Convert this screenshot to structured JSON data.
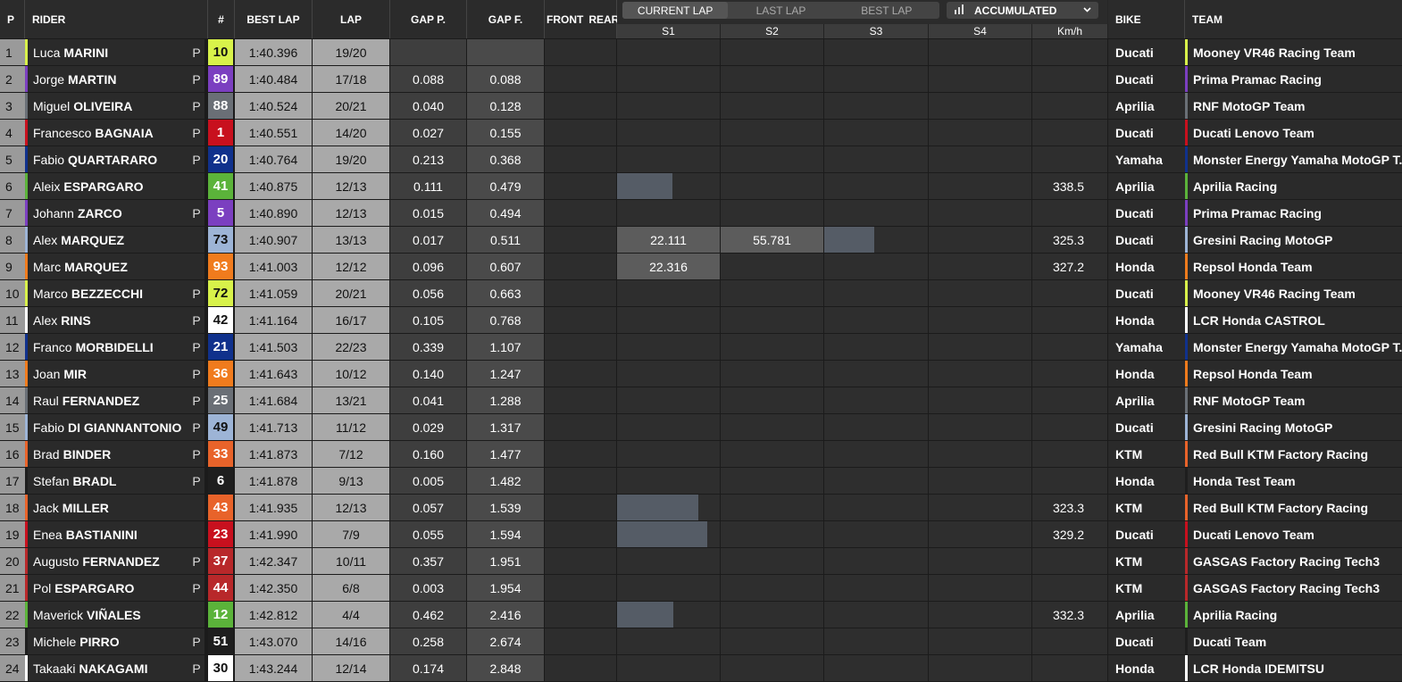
{
  "headers": {
    "p": "P",
    "rider": "RIDER",
    "num": "#",
    "best_lap": "BEST LAP",
    "lap": "LAP",
    "gap_p": "GAP P.",
    "gap_f": "GAP F.",
    "front": "FRONT",
    "rear": "REAR",
    "bike": "BIKE",
    "team": "TEAM",
    "sectors": [
      "S1",
      "S2",
      "S3",
      "S4",
      "Km/h"
    ]
  },
  "tabs": [
    "CURRENT LAP",
    "LAST LAP",
    "BEST LAP"
  ],
  "active_tab": "CURRENT LAP",
  "dropdown": {
    "label": "ACCUMULATED",
    "icon": "bar-chart-icon"
  },
  "rows": [
    {
      "pos": "1",
      "first": "Luca",
      "last": "MARINI",
      "pit": "P",
      "num": "10",
      "color": "#d8f24a",
      "numText": "#111",
      "best": "1:40.396",
      "lap": "19/20",
      "gp": "",
      "gf": "",
      "s1": "",
      "s2": "",
      "s3": "",
      "speed": "",
      "bike": "Ducati",
      "team": "Mooney VR46 Racing Team",
      "progress": 0
    },
    {
      "pos": "2",
      "first": "Jorge",
      "last": "MARTIN",
      "pit": "P",
      "num": "89",
      "color": "#7b3fc0",
      "numText": "#fff",
      "best": "1:40.484",
      "lap": "17/18",
      "gp": "0.088",
      "gf": "0.088",
      "s1": "",
      "s2": "",
      "s3": "",
      "speed": "",
      "bike": "Ducati",
      "team": "Prima Pramac Racing",
      "progress": 0
    },
    {
      "pos": "3",
      "first": "Miguel",
      "last": "OLIVEIRA",
      "pit": "P",
      "num": "88",
      "color": "#6a6f76",
      "numText": "#fff",
      "best": "1:40.524",
      "lap": "20/21",
      "gp": "0.040",
      "gf": "0.128",
      "s1": "",
      "s2": "",
      "s3": "",
      "speed": "",
      "bike": "Aprilia",
      "team": "RNF MotoGP Team",
      "progress": 0
    },
    {
      "pos": "4",
      "first": "Francesco",
      "last": "BAGNAIA",
      "pit": "P",
      "num": "1",
      "color": "#c8101e",
      "numText": "#fff",
      "best": "1:40.551",
      "lap": "14/20",
      "gp": "0.027",
      "gf": "0.155",
      "s1": "",
      "s2": "",
      "s3": "",
      "speed": "",
      "bike": "Ducati",
      "team": "Ducati Lenovo Team",
      "progress": 0
    },
    {
      "pos": "5",
      "first": "Fabio",
      "last": "QUARTARARO",
      "pit": "P",
      "num": "20",
      "color": "#10318c",
      "numText": "#fff",
      "best": "1:40.764",
      "lap": "19/20",
      "gp": "0.213",
      "gf": "0.368",
      "s1": "",
      "s2": "",
      "s3": "",
      "speed": "",
      "bike": "Yamaha",
      "team": "Monster Energy Yamaha MotoGP T...",
      "progress": 0
    },
    {
      "pos": "6",
      "first": "Aleix",
      "last": "ESPARGARO",
      "pit": "",
      "num": "41",
      "color": "#5bb33a",
      "numText": "#fff",
      "best": "1:40.875",
      "lap": "12/13",
      "gp": "0.111",
      "gf": "0.479",
      "s1": "",
      "s2": "",
      "s3": "",
      "speed": "338.5",
      "bike": "Aprilia",
      "team": "Aprilia Racing",
      "progress": 0.54
    },
    {
      "pos": "7",
      "first": "Johann",
      "last": "ZARCO",
      "pit": "P",
      "num": "5",
      "color": "#7b3fc0",
      "numText": "#fff",
      "best": "1:40.890",
      "lap": "12/13",
      "gp": "0.015",
      "gf": "0.494",
      "s1": "",
      "s2": "",
      "s3": "",
      "speed": "",
      "bike": "Ducati",
      "team": "Prima Pramac Racing",
      "progress": 0
    },
    {
      "pos": "8",
      "first": "Alex",
      "last": "MARQUEZ",
      "pit": "",
      "num": "73",
      "color": "#9db4d6",
      "numText": "#111",
      "best": "1:40.907",
      "lap": "13/13",
      "gp": "0.017",
      "gf": "0.511",
      "s1": "22.111",
      "s2": "55.781",
      "s3": "",
      "speed": "325.3",
      "bike": "Ducati",
      "team": "Gresini Racing MotoGP",
      "progress": 2.48
    },
    {
      "pos": "9",
      "first": "Marc",
      "last": "MARQUEZ",
      "pit": "",
      "num": "93",
      "color": "#f07b1d",
      "numText": "#fff",
      "best": "1:41.003",
      "lap": "12/12",
      "gp": "0.096",
      "gf": "0.607",
      "s1": "22.316",
      "s2": "",
      "s3": "",
      "speed": "327.2",
      "bike": "Honda",
      "team": "Repsol Honda Team",
      "progress": 1
    },
    {
      "pos": "10",
      "first": "Marco",
      "last": "BEZZECCHI",
      "pit": "P",
      "num": "72",
      "color": "#d8f24a",
      "numText": "#111",
      "best": "1:41.059",
      "lap": "20/21",
      "gp": "0.056",
      "gf": "0.663",
      "s1": "",
      "s2": "",
      "s3": "",
      "speed": "",
      "bike": "Ducati",
      "team": "Mooney VR46 Racing Team",
      "progress": 0
    },
    {
      "pos": "11",
      "first": "Alex",
      "last": "RINS",
      "pit": "P",
      "num": "42",
      "color": "#ffffff",
      "numText": "#111",
      "best": "1:41.164",
      "lap": "16/17",
      "gp": "0.105",
      "gf": "0.768",
      "s1": "",
      "s2": "",
      "s3": "",
      "speed": "",
      "bike": "Honda",
      "team": "LCR Honda CASTROL",
      "progress": 0
    },
    {
      "pos": "12",
      "first": "Franco",
      "last": "MORBIDELLI",
      "pit": "P",
      "num": "21",
      "color": "#10318c",
      "numText": "#fff",
      "best": "1:41.503",
      "lap": "22/23",
      "gp": "0.339",
      "gf": "1.107",
      "s1": "",
      "s2": "",
      "s3": "",
      "speed": "",
      "bike": "Yamaha",
      "team": "Monster Energy Yamaha MotoGP T...",
      "progress": 0
    },
    {
      "pos": "13",
      "first": "Joan",
      "last": "MIR",
      "pit": "P",
      "num": "36",
      "color": "#f07b1d",
      "numText": "#fff",
      "best": "1:41.643",
      "lap": "10/12",
      "gp": "0.140",
      "gf": "1.247",
      "s1": "",
      "s2": "",
      "s3": "",
      "speed": "",
      "bike": "Honda",
      "team": "Repsol Honda Team",
      "progress": 0
    },
    {
      "pos": "14",
      "first": "Raul",
      "last": "FERNANDEZ",
      "pit": "P",
      "num": "25",
      "color": "#6a6f76",
      "numText": "#fff",
      "best": "1:41.684",
      "lap": "13/21",
      "gp": "0.041",
      "gf": "1.288",
      "s1": "",
      "s2": "",
      "s3": "",
      "speed": "",
      "bike": "Aprilia",
      "team": "RNF MotoGP Team",
      "progress": 0
    },
    {
      "pos": "15",
      "first": "Fabio",
      "last": "DI GIANNANTONIO",
      "pit": "P",
      "num": "49",
      "color": "#9db4d6",
      "numText": "#111",
      "best": "1:41.713",
      "lap": "11/12",
      "gp": "0.029",
      "gf": "1.317",
      "s1": "",
      "s2": "",
      "s3": "",
      "speed": "",
      "bike": "Ducati",
      "team": "Gresini Racing MotoGP",
      "progress": 0
    },
    {
      "pos": "16",
      "first": "Brad",
      "last": "BINDER",
      "pit": "P",
      "num": "33",
      "color": "#e8632a",
      "numText": "#fff",
      "best": "1:41.873",
      "lap": "7/12",
      "gp": "0.160",
      "gf": "1.477",
      "s1": "",
      "s2": "",
      "s3": "",
      "speed": "",
      "bike": "KTM",
      "team": "Red Bull KTM Factory Racing",
      "progress": 0
    },
    {
      "pos": "17",
      "first": "Stefan",
      "last": "BRADL",
      "pit": "P",
      "num": "6",
      "color": "#1e1e1e",
      "numText": "#fff",
      "best": "1:41.878",
      "lap": "9/13",
      "gp": "0.005",
      "gf": "1.482",
      "s1": "",
      "s2": "",
      "s3": "",
      "speed": "",
      "bike": "Honda",
      "team": "Honda Test Team",
      "progress": 0
    },
    {
      "pos": "18",
      "first": "Jack",
      "last": "MILLER",
      "pit": "",
      "num": "43",
      "color": "#e8632a",
      "numText": "#fff",
      "best": "1:41.935",
      "lap": "12/13",
      "gp": "0.057",
      "gf": "1.539",
      "s1": "",
      "s2": "",
      "s3": "",
      "speed": "323.3",
      "bike": "KTM",
      "team": "Red Bull KTM Factory Racing",
      "progress": 0.79
    },
    {
      "pos": "19",
      "first": "Enea",
      "last": "BASTIANINI",
      "pit": "",
      "num": "23",
      "color": "#c8101e",
      "numText": "#fff",
      "best": "1:41.990",
      "lap": "7/9",
      "gp": "0.055",
      "gf": "1.594",
      "s1": "",
      "s2": "",
      "s3": "",
      "speed": "329.2",
      "bike": "Ducati",
      "team": "Ducati Lenovo Team",
      "progress": 0.88
    },
    {
      "pos": "20",
      "first": "Augusto",
      "last": "FERNANDEZ",
      "pit": "P",
      "num": "37",
      "color": "#b8282a",
      "numText": "#fff",
      "best": "1:42.347",
      "lap": "10/11",
      "gp": "0.357",
      "gf": "1.951",
      "s1": "",
      "s2": "",
      "s3": "",
      "speed": "",
      "bike": "KTM",
      "team": "GASGAS Factory Racing Tech3",
      "progress": 0
    },
    {
      "pos": "21",
      "first": "Pol",
      "last": "ESPARGARO",
      "pit": "P",
      "num": "44",
      "color": "#b8282a",
      "numText": "#fff",
      "best": "1:42.350",
      "lap": "6/8",
      "gp": "0.003",
      "gf": "1.954",
      "s1": "",
      "s2": "",
      "s3": "",
      "speed": "",
      "bike": "KTM",
      "team": "GASGAS Factory Racing Tech3",
      "progress": 0
    },
    {
      "pos": "22",
      "first": "Maverick",
      "last": "VIÑALES",
      "pit": "",
      "num": "12",
      "color": "#5bb33a",
      "numText": "#fff",
      "best": "1:42.812",
      "lap": "4/4",
      "gp": "0.462",
      "gf": "2.416",
      "s1": "",
      "s2": "",
      "s3": "",
      "speed": "332.3",
      "bike": "Aprilia",
      "team": "Aprilia Racing",
      "progress": 0.55
    },
    {
      "pos": "23",
      "first": "Michele",
      "last": "PIRRO",
      "pit": "P",
      "num": "51",
      "color": "#1e1e1e",
      "numText": "#fff",
      "best": "1:43.070",
      "lap": "14/16",
      "gp": "0.258",
      "gf": "2.674",
      "s1": "",
      "s2": "",
      "s3": "",
      "speed": "",
      "bike": "Ducati",
      "team": "Ducati Team",
      "progress": 0
    },
    {
      "pos": "24",
      "first": "Takaaki",
      "last": "NAKAGAMI",
      "pit": "P",
      "num": "30",
      "color": "#ffffff",
      "numText": "#111",
      "best": "1:43.244",
      "lap": "12/14",
      "gp": "0.174",
      "gf": "2.848",
      "s1": "",
      "s2": "",
      "s3": "",
      "speed": "",
      "bike": "Honda",
      "team": "LCR Honda IDEMITSU",
      "progress": 0
    }
  ]
}
